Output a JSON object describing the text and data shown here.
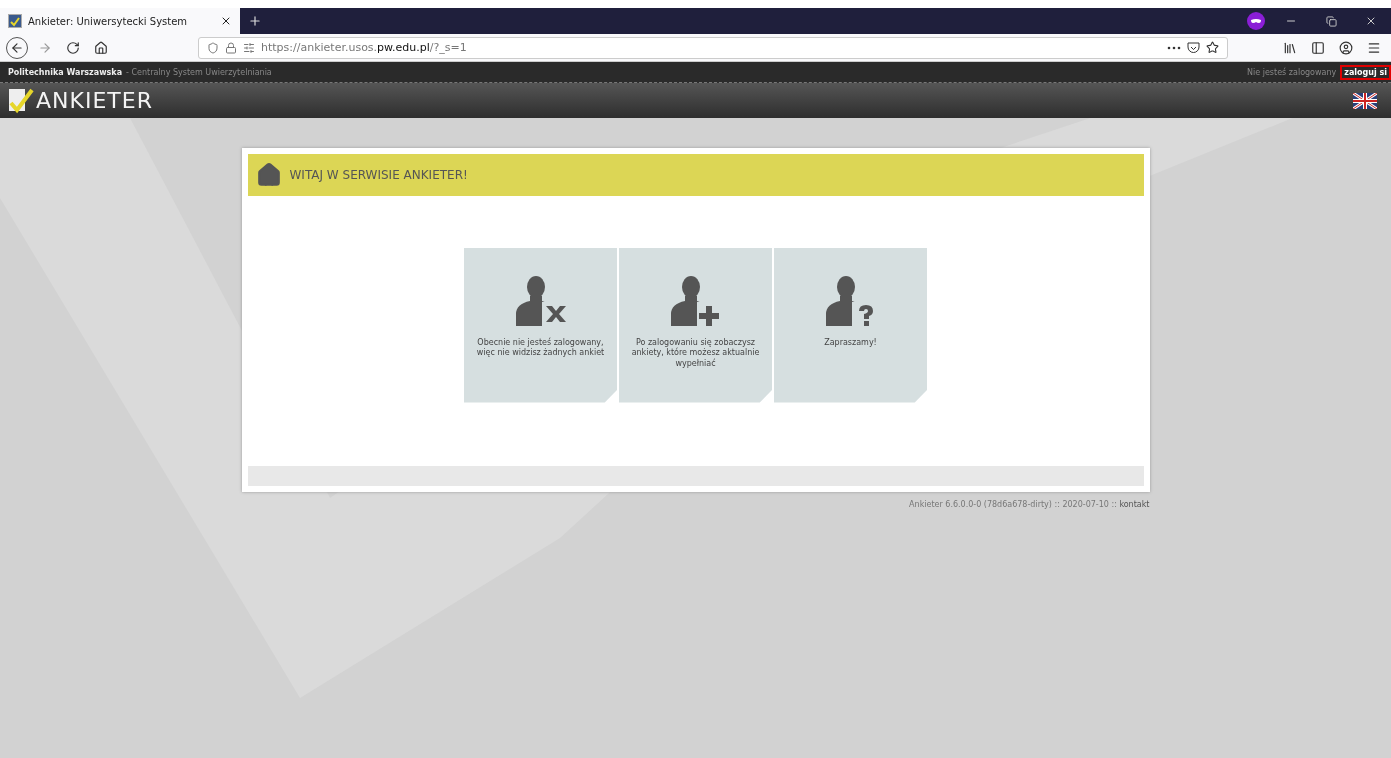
{
  "browser": {
    "tab": {
      "title": "Ankieter: Uniwersytecki System",
      "selected": true
    },
    "url": "https://ankieter.usos.**pw.edu.pl**/?_s=1"
  },
  "site_header": {
    "organization": "Politechnika Warszawska",
    "subtitle": "- Centralny System Uwierzytelniania",
    "login_status": "Nie jesteś zalogowany",
    "login_link": "zaloguj si",
    "logo": "ANKIETER"
  },
  "card": {
    "title": "WITAJ W SERWISIE ANKIETER!",
    "tiles": [
      {
        "kind": "denied",
        "text": "Obecnie nie jesteś zalogowany, więc nie widzisz żadnych ankiet"
      },
      {
        "kind": "add",
        "text": "Po zalogowaniu się zobaczysz ankiety, które możesz aktualnie wypełniać"
      },
      {
        "kind": "question",
        "text": "Zapraszamy!"
      }
    ]
  },
  "footer": {
    "version": "Ankieter 6.6.0.0-0 (78d6a678-dirty) :: 2020-07-10 ::",
    "link": "kontakt"
  }
}
